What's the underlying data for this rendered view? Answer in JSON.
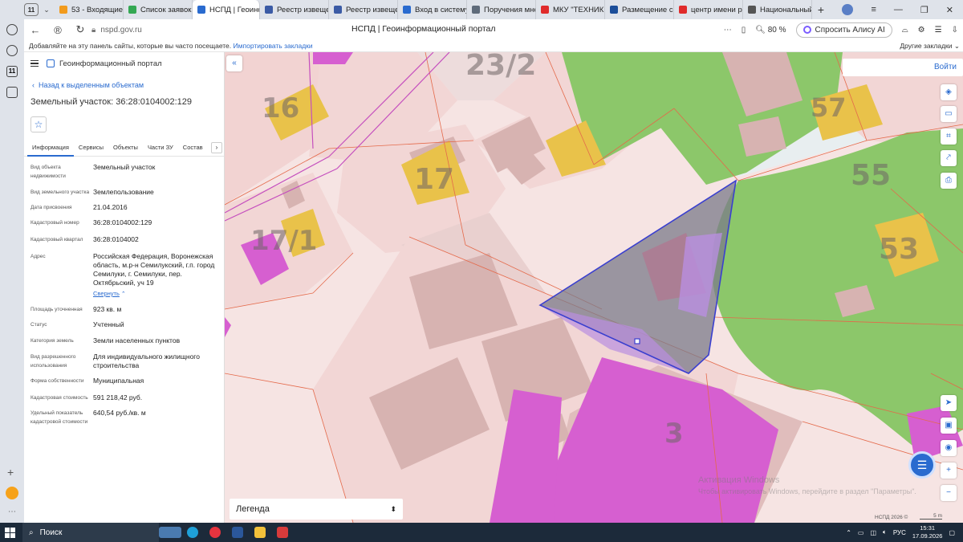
{
  "browser": {
    "tab_count": "11",
    "tabs": [
      {
        "label": "53 - Входящие",
        "color": "#f29b1d"
      },
      {
        "label": "Список заявок",
        "color": "#34a853"
      },
      {
        "label": "НСПД | Геоинф",
        "color": "#2a6bcf",
        "active": true
      },
      {
        "label": "Реестр извеще",
        "color": "#3b5ba5"
      },
      {
        "label": "Реестр извеще",
        "color": "#3b5ba5"
      },
      {
        "label": "Вход в систему",
        "color": "#2a6bcf"
      },
      {
        "label": "Поручения мне",
        "color": "#5f6b7a"
      },
      {
        "label": "МКУ \"ТЕХНИК",
        "color": "#e02b2b"
      },
      {
        "label": "Размещение с",
        "color": "#1c4e9a"
      },
      {
        "label": "центр имени р",
        "color": "#e02b2b"
      },
      {
        "label": "Национальный",
        "color": "#555555"
      }
    ],
    "url": "nspd.gov.ru",
    "page_title": "НСПД | Геоинформационный портал",
    "zoom": "80 %",
    "alice_label": "Спросить Алису AI",
    "bookmarks_text": "Добавляйте на эту панель сайты, которые вы часто посещаете.",
    "bookmarks_link": "Импортировать закладки",
    "other_bookmarks": "Другие закладки"
  },
  "panel": {
    "portal_name": "Геоинформационный портал",
    "back_link": "Назад к выделенным объектам",
    "title": "Земельный участок: 36:28:0104002:129",
    "tabs": [
      "Информация",
      "Сервисы",
      "Объекты",
      "Части ЗУ",
      "Состав"
    ],
    "attributes": [
      {
        "k": "Вид объекта недвижимости",
        "v": "Земельный участок"
      },
      {
        "k": "Вид земельного участка",
        "v": "Землепользование"
      },
      {
        "k": "Дата присвоения",
        "v": "21.04.2016"
      },
      {
        "k": "Кадастровый номер",
        "v": "36:28:0104002:129"
      },
      {
        "k": "Кадастровый квартал",
        "v": "36:28:0104002"
      },
      {
        "k": "Адрес",
        "v": "Российская Федерация, Воронежская область, м.р-н Семилукский, г.п. город Семилуки, г. Семилуки, пер. Октябрьский, уч 19"
      },
      {
        "k": "Площадь уточненная",
        "v": "923 кв. м"
      },
      {
        "k": "Статус",
        "v": "Учтенный"
      },
      {
        "k": "Категория земель",
        "v": "Земли населенных пунктов"
      },
      {
        "k": "Вид разрешенного использования",
        "v": "Для индивидуального жилищного строительства"
      },
      {
        "k": "Форма собственности",
        "v": "Муниципальная"
      },
      {
        "k": "Кадастровая стоимость",
        "v": "591 218,42 руб."
      },
      {
        "k": "Удельный показатель кадастровой стоимости",
        "v": "640,54 руб./кв. м"
      }
    ],
    "collapse_link": "Свернуть"
  },
  "map": {
    "login": "Войти",
    "legend": "Легенда",
    "labels": [
      "23/2",
      "16",
      "17",
      "17/1",
      "57",
      "55",
      "53",
      "3"
    ],
    "watermark_title": "Активация Windows",
    "watermark_text": "Чтобы активировать Windows, перейдите в раздел \"Параметры\".",
    "copyright": "НСПД 2026 ©",
    "scale": "5 m",
    "colors": {
      "parcel_outline": "#3a3fcf",
      "greenery": "#8cc76a",
      "building": "#d8a6a4",
      "commercial": "#d65fd0"
    }
  },
  "taskbar": {
    "search": "Поиск",
    "lang": "РУС",
    "time": "15:31",
    "date": "17.09.2026"
  }
}
